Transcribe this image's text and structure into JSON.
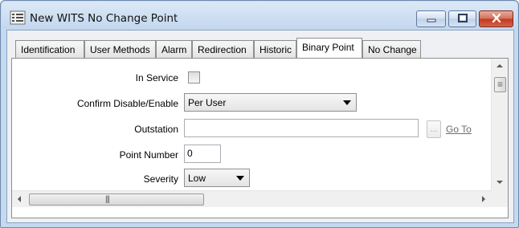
{
  "window": {
    "title": "New WITS No Change Point",
    "icon": "grid-list-icon"
  },
  "tabs": [
    {
      "label": "Identification",
      "active": false
    },
    {
      "label": "User Methods",
      "active": false
    },
    {
      "label": "Alarm",
      "active": false
    },
    {
      "label": "Redirection",
      "active": false
    },
    {
      "label": "Historic",
      "active": false
    },
    {
      "label": "Binary Point",
      "active": true
    },
    {
      "label": "No Change",
      "active": false
    }
  ],
  "form": {
    "in_service": {
      "label": "In Service",
      "checked": false
    },
    "confirm_disable_enable": {
      "label": "Confirm Disable/Enable",
      "value": "Per User"
    },
    "outstation": {
      "label": "Outstation",
      "value": "",
      "browse_label": "...",
      "goto_label": "Go To"
    },
    "point_number": {
      "label": "Point Number",
      "value": "0"
    },
    "severity": {
      "label": "Severity",
      "value": "Low"
    }
  },
  "scrollbars": {
    "horizontal_grip": "|||",
    "vertical_grip": "≡"
  }
}
